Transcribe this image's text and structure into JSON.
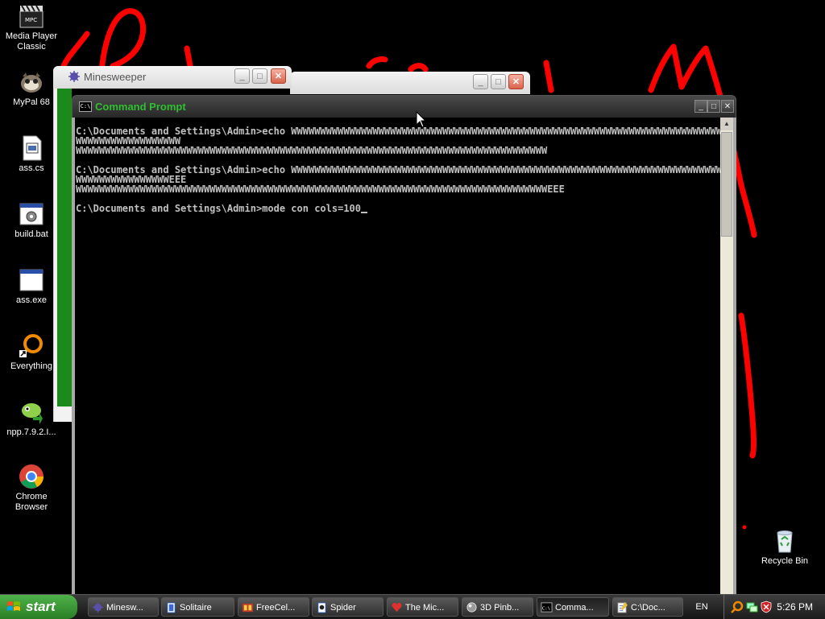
{
  "desktop": {
    "icons": [
      {
        "label": "Media Player Classic",
        "icon": "media-player-classic-icon"
      },
      {
        "label": "MyPal 68",
        "icon": "mypal-icon"
      },
      {
        "label": "ass.cs",
        "icon": "cs-file-icon"
      },
      {
        "label": "build.bat",
        "icon": "bat-file-icon"
      },
      {
        "label": "ass.exe",
        "icon": "exe-file-icon"
      },
      {
        "label": "Everything",
        "icon": "everything-icon"
      },
      {
        "label": "npp.7.9.2.I...",
        "icon": "notepadpp-installer-icon"
      },
      {
        "label": "Chrome Browser",
        "icon": "chrome-icon"
      },
      {
        "label": "Recycle Bin",
        "icon": "recycle-bin-icon"
      }
    ],
    "scribble_color": "#ff0000"
  },
  "windows": {
    "minesweeper": {
      "title": "Minesweeper"
    },
    "command_prompt": {
      "title": "Command Prompt",
      "lines": [
        "C:\\Documents and Settings\\Admin>echo WWWWWWWWWWWWWWWWWWWWWWWWWWWWWWWWWWWWWWWWWWWWWWWWWWWWWWWWWWWWWWWWWWWWWWWWWWWWWWWWWWWWWW",
        "WWWWWWWWWWWWWWWWWW",
        "WWWWWWWWWWWWWWWWWWWWWWWWWWWWWWWWWWWWWWWWWWWWWWWWWWWWWWWWWWWWWWWWWWWWWWWWWWWWWWWWW",
        "",
        "C:\\Documents and Settings\\Admin>echo WWWWWWWWWWWWWWWWWWWWWWWWWWWWWWWWWWWWWWWWWWWWWWWWWWWWWWWWWWWWWWWWWWWWWWWWWWWWWWWWWWWWWW",
        "WWWWWWWWWWWWWWWWEEE",
        "WWWWWWWWWWWWWWWWWWWWWWWWWWWWWWWWWWWWWWWWWWWWWWWWWWWWWWWWWWWWWWWWWWWWWWWWWWWWWWWWWEEE",
        "",
        "C:\\Documents and Settings\\Admin>mode con cols=100"
      ]
    }
  },
  "taskbar": {
    "start_label": "start",
    "buttons": [
      {
        "label": "Minesw...",
        "icon": "minesweeper-icon"
      },
      {
        "label": "Solitaire",
        "icon": "solitaire-icon"
      },
      {
        "label": "FreeCel...",
        "icon": "freecell-icon"
      },
      {
        "label": "Spider",
        "icon": "spider-icon"
      },
      {
        "label": "The Mic...",
        "icon": "hearts-icon"
      },
      {
        "label": "3D Pinb...",
        "icon": "pinball-icon"
      },
      {
        "label": "Comma...",
        "icon": "cmd-icon",
        "active": true
      },
      {
        "label": "C:\\Doc...",
        "icon": "notepad-icon"
      }
    ],
    "language": "EN",
    "clock": "5:26 PM"
  }
}
